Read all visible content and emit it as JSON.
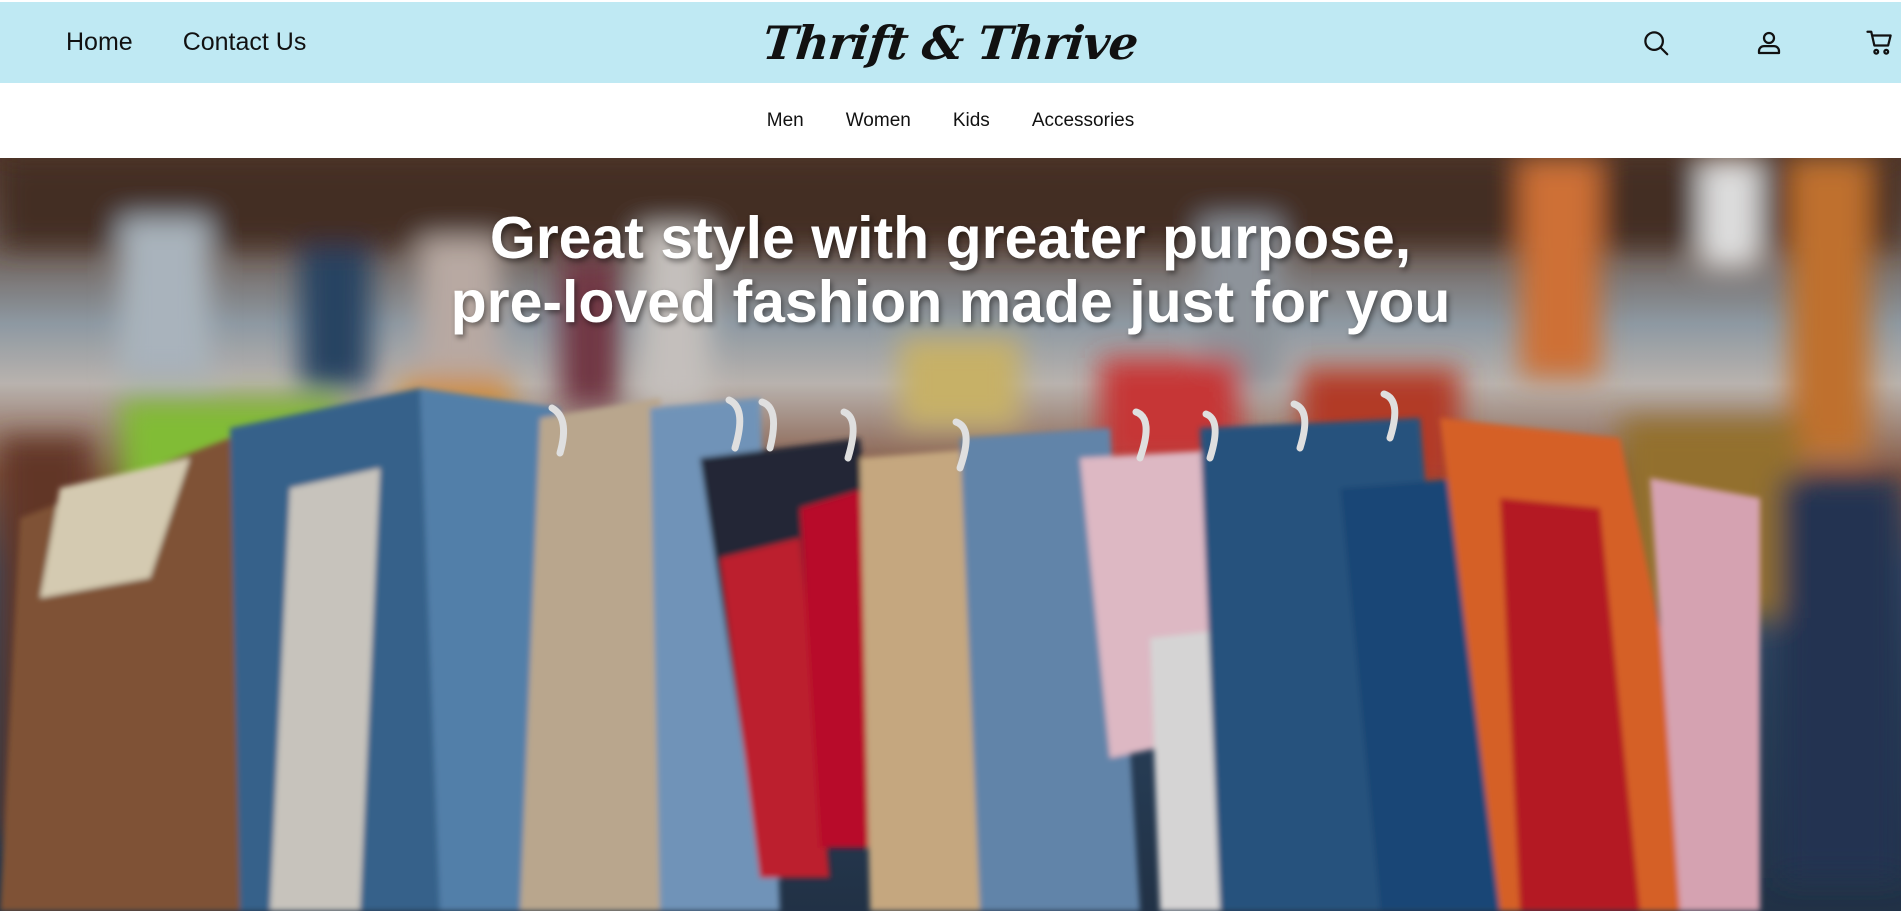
{
  "header": {
    "nav": [
      {
        "label": "Home"
      },
      {
        "label": "Contact Us"
      }
    ],
    "logo_text": "Thrift & Thrive",
    "icons": [
      "search-icon",
      "account-icon",
      "cart-icon"
    ],
    "background": "#bfe9f3"
  },
  "categories": [
    {
      "label": "Men"
    },
    {
      "label": "Women"
    },
    {
      "label": "Kids"
    },
    {
      "label": "Accessories"
    }
  ],
  "hero": {
    "line1": "Great style with greater purpose,",
    "line2": "pre-loved fashion made just for you"
  }
}
